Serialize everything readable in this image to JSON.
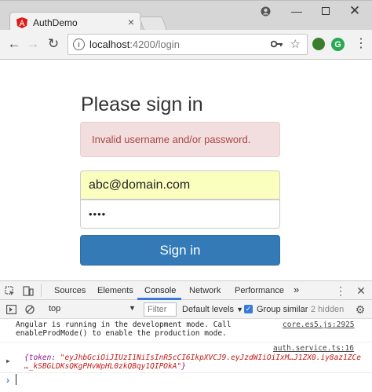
{
  "browser": {
    "tab_title": "AuthDemo",
    "url_host": "localhost",
    "url_path": ":4200/login",
    "ext_letter": "G"
  },
  "page": {
    "heading": "Please sign in",
    "alert_text": "Invalid username and/or password.",
    "email_value": "abc@domain.com",
    "password_value": "••••",
    "signin_label": "Sign in"
  },
  "devtools": {
    "tabs": [
      "Sources",
      "Elements",
      "Console",
      "Network",
      "Performance"
    ],
    "more": "»",
    "context": "top",
    "filter_placeholder": "Filter",
    "levels": "Default levels",
    "group_similar": "Group similar",
    "hidden": "2 hidden",
    "messages": [
      {
        "text": "Angular is running in the development mode. Call\nenableProdMode() to enable the production mode.",
        "source": "core.es5.js:2925"
      },
      {
        "source": "auth.service.ts:16",
        "obj_open": "{token: ",
        "token_line1": "\"eyJhbGciOiJIUzI1NiIsInR5cCI6IkpXVCJ9.eyJzdWIiOiIxM…J1ZX0.iy8az1ZCe",
        "token_line2": "…_kSBGLDKsQKgPHvWpHL0zkQBqy1QIPOkA\"",
        "obj_close": "}"
      }
    ]
  },
  "colors": {
    "primary": "#337ab7",
    "alert_bg": "#f2dede",
    "alert_text": "#a94442",
    "autofill": "#faffbd"
  }
}
